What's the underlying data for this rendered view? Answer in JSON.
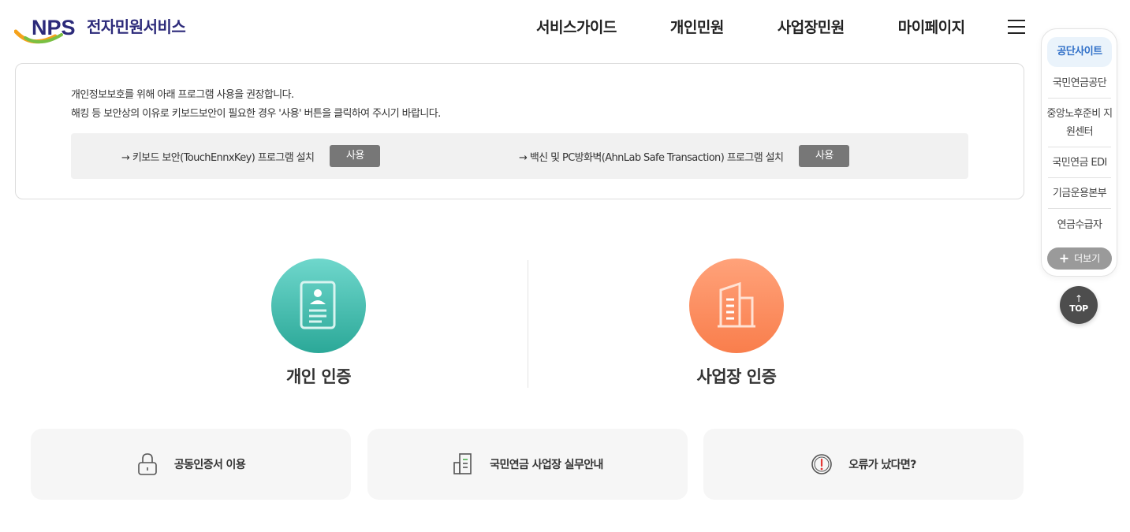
{
  "header": {
    "logo_mark": "NPS",
    "logo_text": "전자민원서비스",
    "nav": [
      "서비스가이드",
      "개인민원",
      "사업장민원",
      "마이페이지"
    ]
  },
  "notice": {
    "line1": "개인정보보호를 위해 아래 프로그램 사용을 권장합니다.",
    "line2": "해킹 등 보안상의 이유로 키보드보안이 필요한 경우 '사용' 버튼을 클릭하여 주시기 바랍니다.",
    "keyboard_security": "→ 키보드 보안(TouchEnnxKey) 프로그램 설치",
    "firewall": "→ 백신 및 PC방화벽(AhnLab Safe Transaction) 프로그램 설치",
    "use_label": "사용"
  },
  "auth": {
    "personal_label": "개인 인증",
    "business_label": "사업장 인증"
  },
  "cards": {
    "certificate": "공동인증서 이용",
    "business_guide": "국민연금 사업장 실무안내",
    "error": "오류가 났다면?"
  },
  "quick": {
    "title": "공단사이트",
    "links": [
      "국민연금공단",
      "중앙노후준비 지원센터",
      "국민연금 EDI",
      "기금운용본부",
      "연금수급자"
    ],
    "more_label": "더보기",
    "top_label": "TOP"
  },
  "colors": {
    "brand_navy": "#2c2a7a",
    "brand_teal": "#2ba898",
    "brand_orange": "#f97e4c",
    "quick_accent": "#2f6fc8"
  }
}
